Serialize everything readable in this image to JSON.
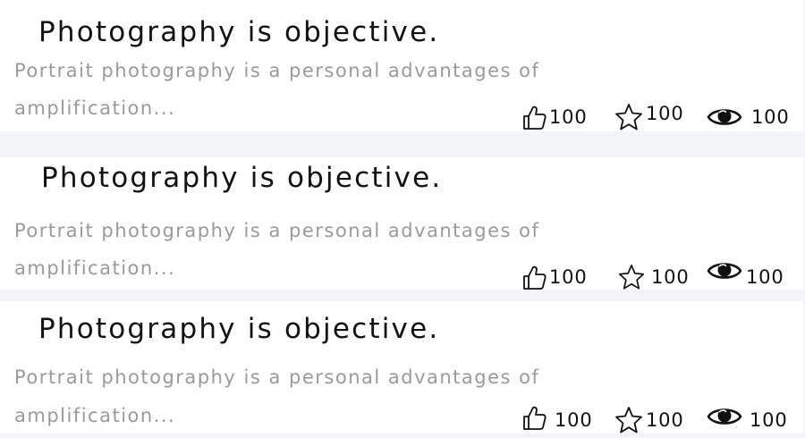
{
  "articles": [
    {
      "title": "Photography is objective.",
      "description_line1": "Portrait photography is a personal advantages of",
      "description_line2": "amplification...",
      "likes": "100",
      "favorites": "100",
      "views": "100"
    },
    {
      "title": "Photography is objective.",
      "description_line1": "Portrait photography is a personal advantages of",
      "description_line2": "amplification...",
      "likes": "100",
      "favorites": "100",
      "views": "100"
    },
    {
      "title": "Photography is objective.",
      "description_line1": "Portrait photography is a personal advantages of",
      "description_line2": "amplification...",
      "likes": "100",
      "favorites": "100",
      "views": "100"
    }
  ],
  "icons": {
    "like": "thumbs-up-icon",
    "favorite": "star-icon",
    "view": "eye-icon"
  },
  "colors": {
    "background": "#f3f5f8",
    "card": "#ffffff",
    "title": "#121212",
    "description": "#9a9a9a",
    "icon": "#111111"
  }
}
